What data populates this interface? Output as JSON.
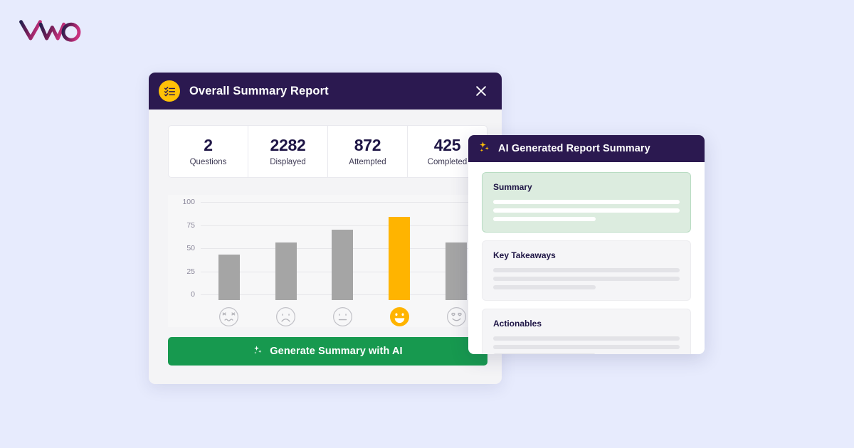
{
  "brand": {
    "logo_text": "VWO",
    "logo_gradient_start": "#24204f",
    "logo_gradient_end": "#c2307f"
  },
  "page": {
    "background_color": "#e7ebfd"
  },
  "report_card": {
    "header": {
      "icon": "checklist-icon",
      "icon_bg_color": "#ffc107",
      "title": "Overall Summary Report",
      "close_icon": "close-icon",
      "background_color": "#2b1950"
    },
    "stats": [
      {
        "value": "2",
        "label": "Questions"
      },
      {
        "value": "2282",
        "label": "Displayed"
      },
      {
        "value": "872",
        "label": "Attempted"
      },
      {
        "value": "425",
        "label": "Completed"
      }
    ],
    "generate_button": {
      "label": "Generate Summary with AI",
      "icon": "sparkle-icon",
      "color": "#17994f"
    }
  },
  "chart_data": {
    "type": "bar",
    "title": "",
    "xlabel": "",
    "ylabel": "",
    "categories": [
      "confounded-face",
      "frowning-face",
      "neutral-face",
      "grinning-face",
      "heart-eyes-face"
    ],
    "values": [
      49,
      62,
      76,
      90,
      62
    ],
    "highlight_index": 3,
    "bar_color": "#a5a5a5",
    "highlight_color": "#ffb400",
    "ylim": [
      0,
      100
    ],
    "yticks": [
      "100",
      "75",
      "50",
      "25",
      "0"
    ],
    "ytick_values": [
      100,
      75,
      50,
      25,
      0
    ],
    "grid": true,
    "legend": "none",
    "plot_background": "#f7f7f8"
  },
  "ai_panel": {
    "header": {
      "title": "AI Generated Report Summary",
      "icon": "sparkle-icon",
      "background_color": "#2b1950"
    },
    "cards": [
      {
        "title": "Summary",
        "style": "green",
        "skeleton_widths": [
          "100%",
          "100%",
          "55%"
        ]
      },
      {
        "title": "Key Takeaways",
        "style": "grey",
        "skeleton_widths": [
          "100%",
          "100%",
          "55%"
        ]
      },
      {
        "title": "Actionables",
        "style": "grey",
        "skeleton_widths": [
          "100%",
          "100%",
          "55%"
        ]
      }
    ]
  }
}
